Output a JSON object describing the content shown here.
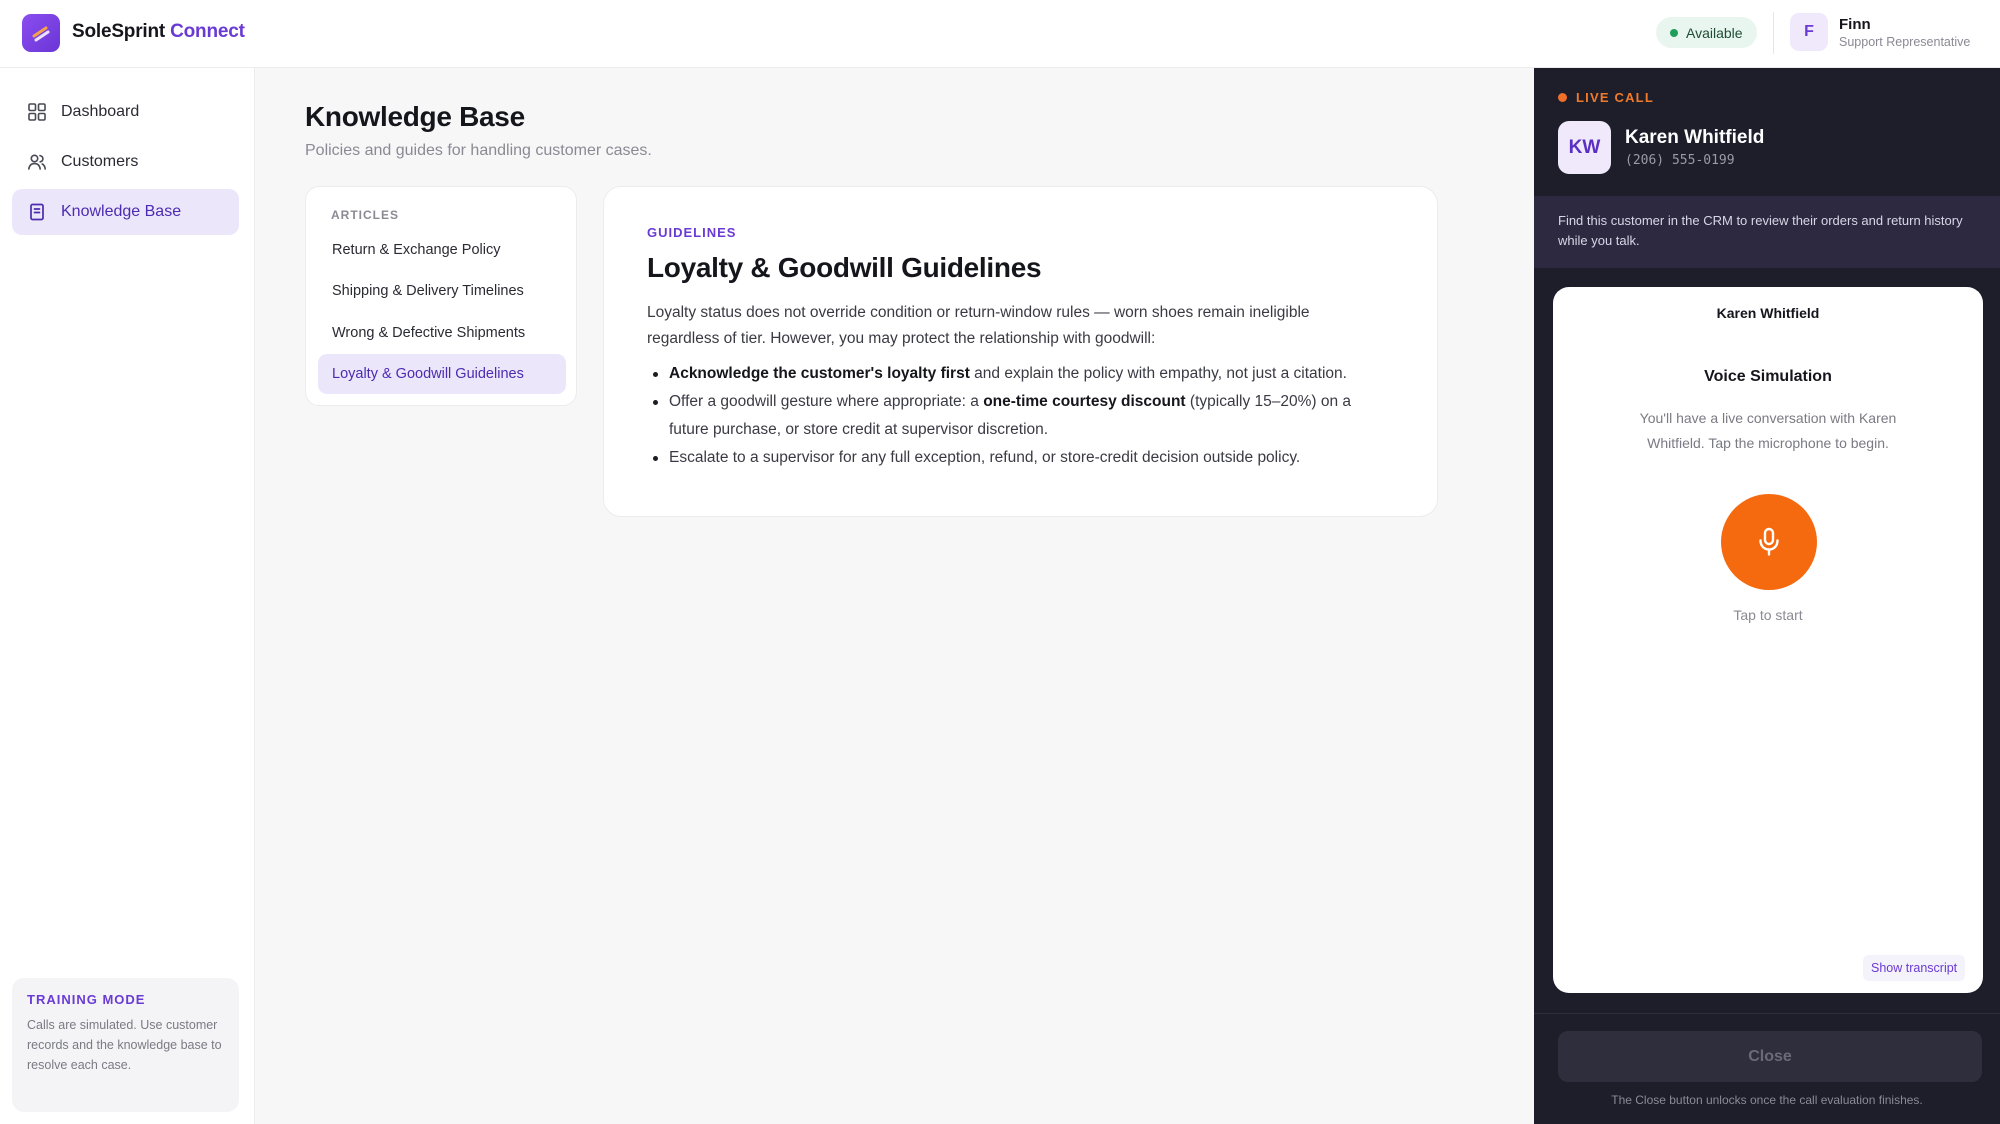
{
  "app": {
    "brand_main": "SoleSprint",
    "brand_accent": "Connect",
    "status": "Available",
    "user": {
      "initial": "F",
      "name": "Finn",
      "role": "Support Representative"
    }
  },
  "sidebar": {
    "items": [
      {
        "label": "Dashboard",
        "icon": "grid-icon"
      },
      {
        "label": "Customers",
        "icon": "users-icon"
      },
      {
        "label": "Knowledge Base",
        "icon": "book-icon",
        "active": true
      }
    ],
    "training": {
      "title": "TRAINING MODE",
      "text": "Calls are simulated. Use customer records and the knowledge base to resolve each case."
    }
  },
  "main": {
    "title": "Knowledge Base",
    "subtitle": "Policies and guides for handling customer cases.",
    "articles_label": "ARTICLES",
    "articles": [
      "Return & Exchange Policy",
      "Shipping & Delivery Timelines",
      "Wrong & Defective Shipments",
      "Loyalty & Goodwill Guidelines"
    ],
    "active_article": 3,
    "content": {
      "tag": "GUIDELINES",
      "title": "Loyalty & Goodwill Guidelines",
      "intro": "Loyalty status does not override condition or return-window rules — worn shoes remain ineligible regardless of tier. However, you may protect the relationship with goodwill:",
      "bullets": [
        {
          "bold_lead": "Acknowledge the customer's loyalty first",
          "rest": " and explain the policy with empathy, not just a citation."
        },
        {
          "lead": "Offer a goodwill gesture where appropriate: a ",
          "bold": "one-time courtesy discount",
          "rest": " (typically 15–20%) on a future purchase, or store credit at supervisor discretion."
        },
        {
          "text": "Escalate to a supervisor for any full exception, refund, or store-credit decision outside policy."
        }
      ]
    }
  },
  "call": {
    "live_label": "LIVE CALL",
    "caller_initials": "KW",
    "caller_name": "Karen Whitfield",
    "caller_phone": "(206) 555-0199",
    "hint": "Find this customer in the CRM to review their orders and return history while you talk.",
    "sim": {
      "caller": "Karen Whitfield",
      "title": "Voice Simulation",
      "description": "You'll have a live conversation with Karen Whitfield. Tap the microphone to begin.",
      "tap_label": "Tap to start",
      "transcript_button": "Show transcript"
    },
    "close_label": "Close",
    "close_note": "The Close button unlocks once the call evaluation finishes."
  },
  "colors": {
    "accent": "#6a3bd4",
    "mic": "#f66a0f",
    "live": "#f07a2a",
    "panel_bg": "#1e1e2a",
    "available": "#1f9d5b"
  }
}
